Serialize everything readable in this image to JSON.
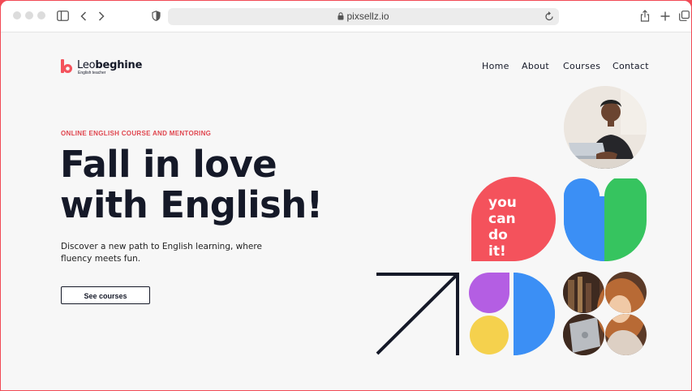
{
  "browser": {
    "url": "pixsellz.io",
    "icons": [
      "sidebar-icon",
      "back-icon",
      "forward-icon",
      "shield-icon",
      "lock-icon",
      "reload-icon",
      "share-icon",
      "new-tab-icon",
      "tabs-icon"
    ]
  },
  "site": {
    "logo": {
      "name_light": "Leo",
      "name_bold": "beghine",
      "tagline": "English teacher",
      "mark_letter": "b"
    },
    "nav": [
      "Home",
      "About",
      "Courses",
      "Contact"
    ],
    "hero": {
      "eyebrow": "ONLINE ENGLISH COURSE AND MENTORING",
      "title_line1": "Fall in love",
      "title_line2": "with English!",
      "subtitle": "Discover a new path to English learning, where fluency meets fun.",
      "cta": "See courses"
    },
    "art": {
      "badge_text": [
        "you",
        "can",
        "do it!"
      ],
      "colors": {
        "coral": "#f4525c",
        "blue": "#3b8ff5",
        "green": "#36c45f",
        "purple": "#b45ee3",
        "yellow": "#f5d14d",
        "navy": "#151928"
      }
    }
  },
  "colors": {
    "accent": "#e0454e",
    "text": "#151928",
    "background": "#f7f7f7",
    "frame": "#f14a55"
  }
}
